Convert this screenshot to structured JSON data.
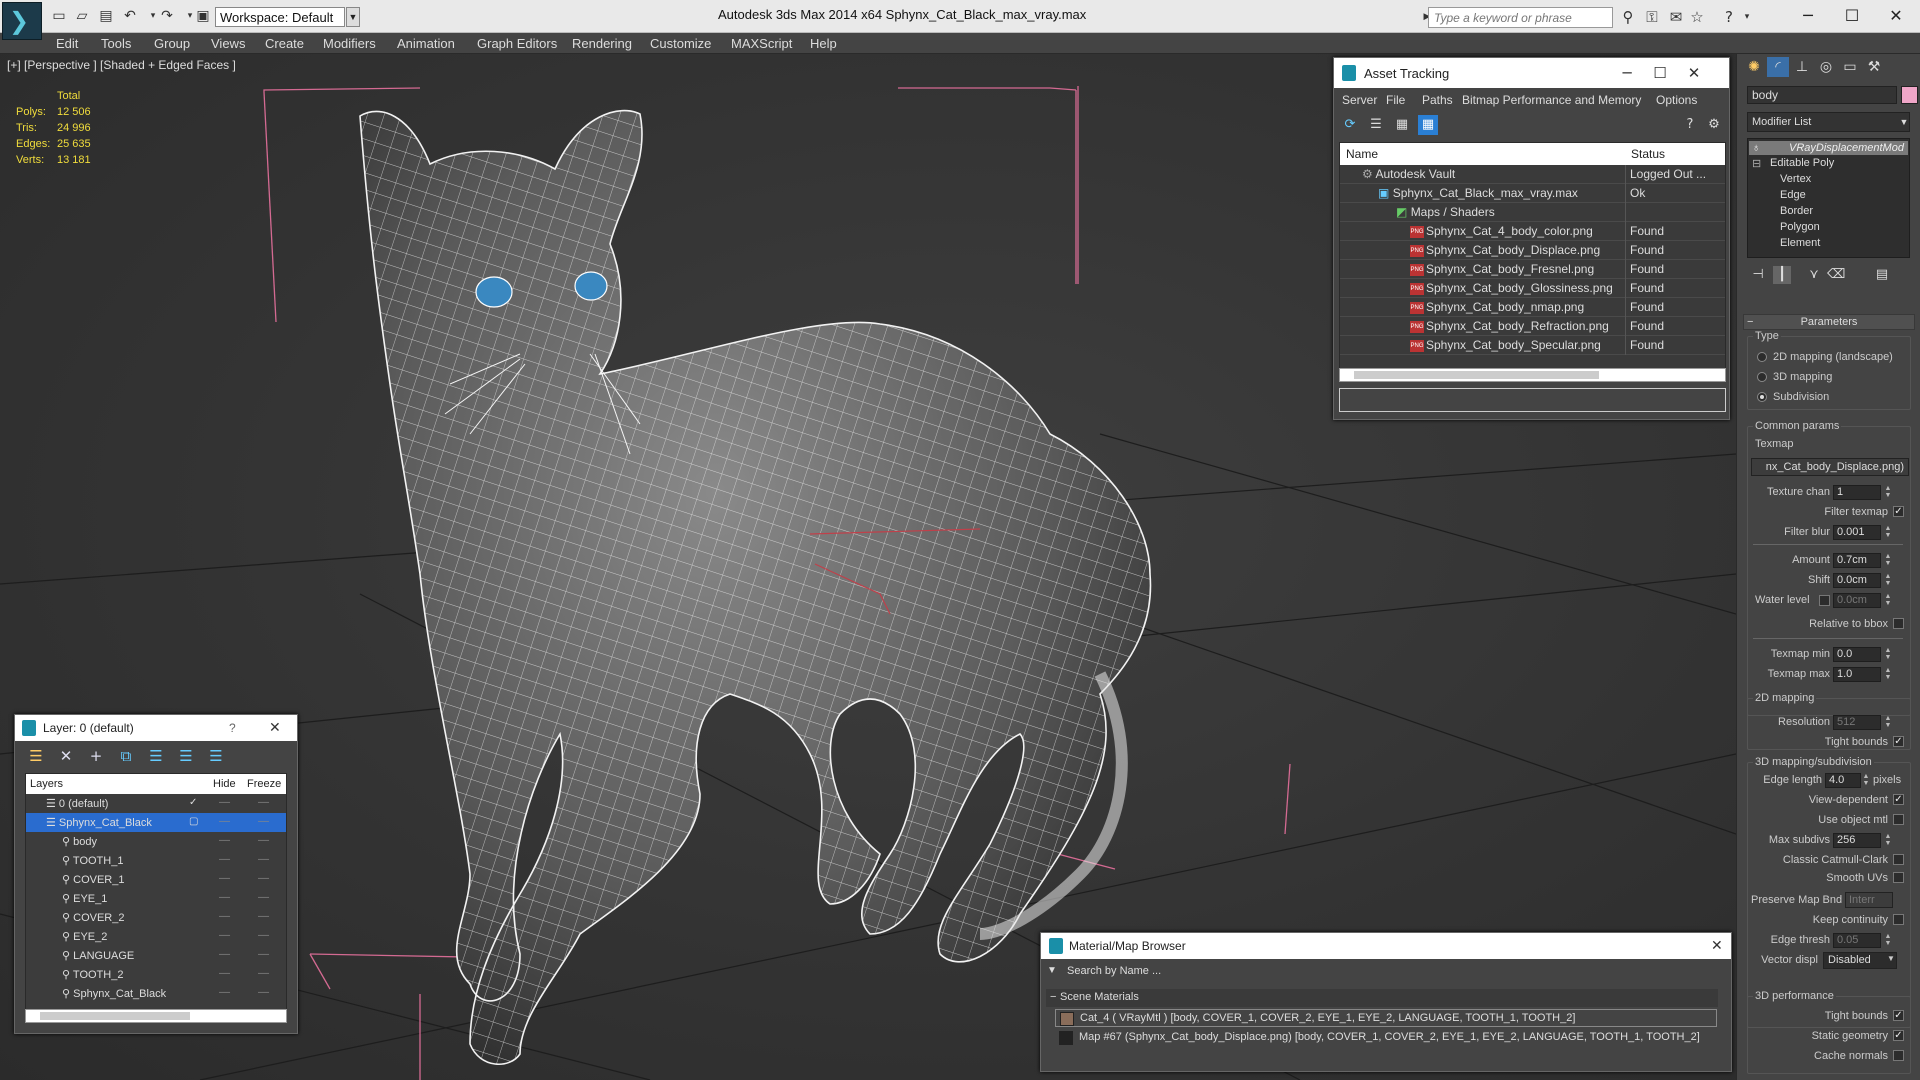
{
  "app": {
    "title": "Autodesk 3ds Max  2014 x64      Sphynx_Cat_Black_max_vray.max",
    "workspace": "Workspace: Default",
    "search_placeholder": "Type a keyword or phrase"
  },
  "menu": [
    "Edit",
    "Tools",
    "Group",
    "Views",
    "Create",
    "Modifiers",
    "Animation",
    "Graph Editors",
    "Rendering",
    "Customize",
    "MAXScript",
    "Help"
  ],
  "viewport": {
    "label": "[+] [Perspective ] [Shaded + Edged Faces ]",
    "stats": {
      "header": "Total",
      "rows": [
        {
          "k": "Polys:",
          "v": "12 506"
        },
        {
          "k": "Tris:",
          "v": "24 996"
        },
        {
          "k": "Edges:",
          "v": "25 635"
        },
        {
          "k": "Verts:",
          "v": "13 181"
        }
      ]
    }
  },
  "asset_tracking": {
    "title": "Asset Tracking",
    "menu": [
      "Server",
      "File",
      "Paths",
      "Bitmap Performance and Memory",
      "Options"
    ],
    "columns": [
      "Name",
      "Status"
    ],
    "rows": [
      {
        "name": "Autodesk Vault",
        "status": "Logged Out ..."
      },
      {
        "name": "Sphynx_Cat_Black_max_vray.max",
        "status": "Ok"
      },
      {
        "name": "Maps / Shaders",
        "status": ""
      },
      {
        "name": "Sphynx_Cat_4_body_color.png",
        "status": "Found"
      },
      {
        "name": "Sphynx_Cat_body_Displace.png",
        "status": "Found"
      },
      {
        "name": "Sphynx_Cat_body_Fresnel.png",
        "status": "Found"
      },
      {
        "name": "Sphynx_Cat_body_Glossiness.png",
        "status": "Found"
      },
      {
        "name": "Sphynx_Cat_body_nmap.png",
        "status": "Found"
      },
      {
        "name": "Sphynx_Cat_body_Refraction.png",
        "status": "Found"
      },
      {
        "name": "Sphynx_Cat_body_Specular.png",
        "status": "Found"
      }
    ]
  },
  "layer_dialog": {
    "title": "Layer: 0 (default)",
    "help": "?",
    "columns": [
      "Layers",
      "Hide",
      "Freeze"
    ],
    "rows": [
      {
        "name": "0 (default)"
      },
      {
        "name": "Sphynx_Cat_Black"
      },
      {
        "name": "body"
      },
      {
        "name": "TOOTH_1"
      },
      {
        "name": "COVER_1"
      },
      {
        "name": "EYE_1"
      },
      {
        "name": "COVER_2"
      },
      {
        "name": "EYE_2"
      },
      {
        "name": "LANGUAGE"
      },
      {
        "name": "TOOTH_2"
      },
      {
        "name": "Sphynx_Cat_Black"
      }
    ]
  },
  "material_browser": {
    "title": "Material/Map Browser",
    "search": "Search by Name ...",
    "section": "Scene Materials",
    "items": [
      "Cat_4  ( VRayMtl ) [body, COVER_1, COVER_2, EYE_1, EYE_2, LANGUAGE, TOOTH_1, TOOTH_2]",
      "Map #67 (Sphynx_Cat_body_Displace.png) [body, COVER_1, COVER_2, EYE_1, EYE_2, LANGUAGE, TOOTH_1, TOOTH_2]"
    ]
  },
  "command_panel": {
    "object_name": "body",
    "object_color": "#f0a6c8",
    "modifier_list": "Modifier List",
    "stack": {
      "selected": "VRayDisplacementMod",
      "base": "Editable Poly",
      "subs": [
        "Vertex",
        "Edge",
        "Border",
        "Polygon",
        "Element"
      ]
    },
    "params": {
      "rollout": "Parameters",
      "type_label": "Type",
      "types": [
        "2D mapping (landscape)",
        "3D mapping",
        "Subdivision"
      ],
      "selected_type": "Subdivision",
      "common": "Common params",
      "texmap_label": "Texmap",
      "texmap_value": "nx_Cat_body_Displace.png)",
      "texture_chan_label": "Texture chan",
      "texture_chan": "1",
      "filter_texmap_label": "Filter texmap",
      "filter_blur_label": "Filter blur",
      "filter_blur": "0.001",
      "amount_label": "Amount",
      "amount": "0.7cm",
      "shift_label": "Shift",
      "shift": "0.0cm",
      "water_label": "Water level",
      "water": "0.0cm",
      "relative_label": "Relative to bbox",
      "texmap_min_label": "Texmap min",
      "texmap_min": "0.0",
      "texmap_max_label": "Texmap max",
      "texmap_max": "1.0",
      "map2d": "2D mapping",
      "resolution_label": "Resolution",
      "resolution": "512",
      "tight_bounds_label": "Tight bounds",
      "map3d": "3D mapping/subdivision",
      "edge_length_label": "Edge length",
      "edge_length": "4.0",
      "pixels_label": "pixels",
      "view_dependent_label": "View-dependent",
      "use_object_mtl_label": "Use object mtl",
      "max_subdivs_label": "Max subdivs",
      "max_subdivs": "256",
      "catmull_label": "Classic Catmull-Clark",
      "smooth_uvs_label": "Smooth UVs",
      "preserve_label": "Preserve Map Bnd",
      "preserve_value": "Interr",
      "keep_cont_label": "Keep continuity",
      "edge_thresh_label": "Edge thresh",
      "edge_thresh": "0.05",
      "vector_label": "Vector displ",
      "vector_value": "Disabled",
      "perf": "3D performance",
      "tight_bounds2_label": "Tight bounds",
      "static_label": "Static geometry",
      "cache_label": "Cache normals"
    }
  }
}
